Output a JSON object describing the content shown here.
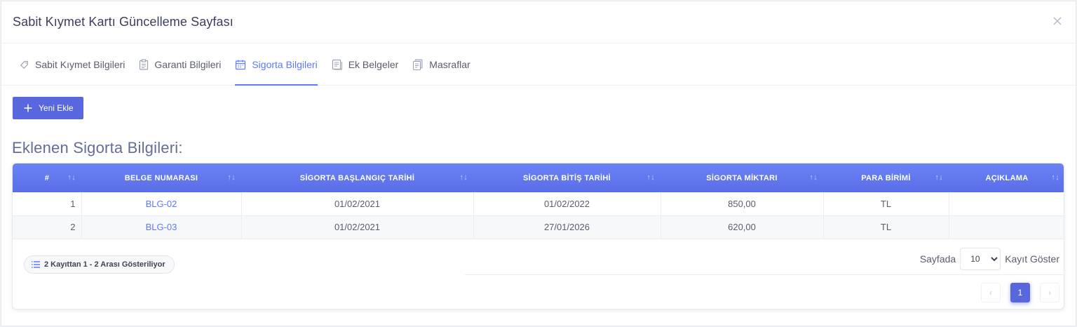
{
  "modal": {
    "title": "Sabit Kıymet Kartı Güncelleme Sayfası"
  },
  "tabs": [
    {
      "label": "Sabit Kıymet Bilgileri",
      "icon": "tag-icon"
    },
    {
      "label": "Garanti Bilgileri",
      "icon": "clipboard-icon"
    },
    {
      "label": "Sigorta Bilgileri",
      "icon": "calendar-icon",
      "active": true
    },
    {
      "label": "Ek Belgeler",
      "icon": "document-icon"
    },
    {
      "label": "Masraflar",
      "icon": "files-icon"
    }
  ],
  "toolbar": {
    "add_label": "Yeni Ekle"
  },
  "section": {
    "title": "Eklenen Sigorta Bilgileri:"
  },
  "table": {
    "columns": [
      "#",
      "BELGE NUMARASI",
      "SİGORTA BAŞLANGIÇ TARİHİ",
      "SİGORTA BİTİŞ TARİHİ",
      "SİGORTA MİKTARI",
      "PARA BİRİMİ",
      "AÇIKLAMA"
    ],
    "rows": [
      [
        "1",
        "BLG-02",
        "01/02/2021",
        "01/02/2022",
        "850,00",
        "TL",
        ""
      ],
      [
        "2",
        "BLG-03",
        "01/02/2021",
        "27/01/2026",
        "620,00",
        "TL",
        ""
      ]
    ]
  },
  "footer": {
    "info": "2 Kayıttan 1 - 2 Arası Gösteriliyor",
    "page_size_prefix": "Sayfada",
    "page_size_value": "10",
    "page_size_suffix": "Kayıt Göster",
    "current_page": "1",
    "prev_glyph": "‹",
    "next_glyph": "›"
  },
  "colors": {
    "accent": "#5d78ff",
    "button": "#5867dd",
    "header_gradient_top": "#6b82f5"
  }
}
